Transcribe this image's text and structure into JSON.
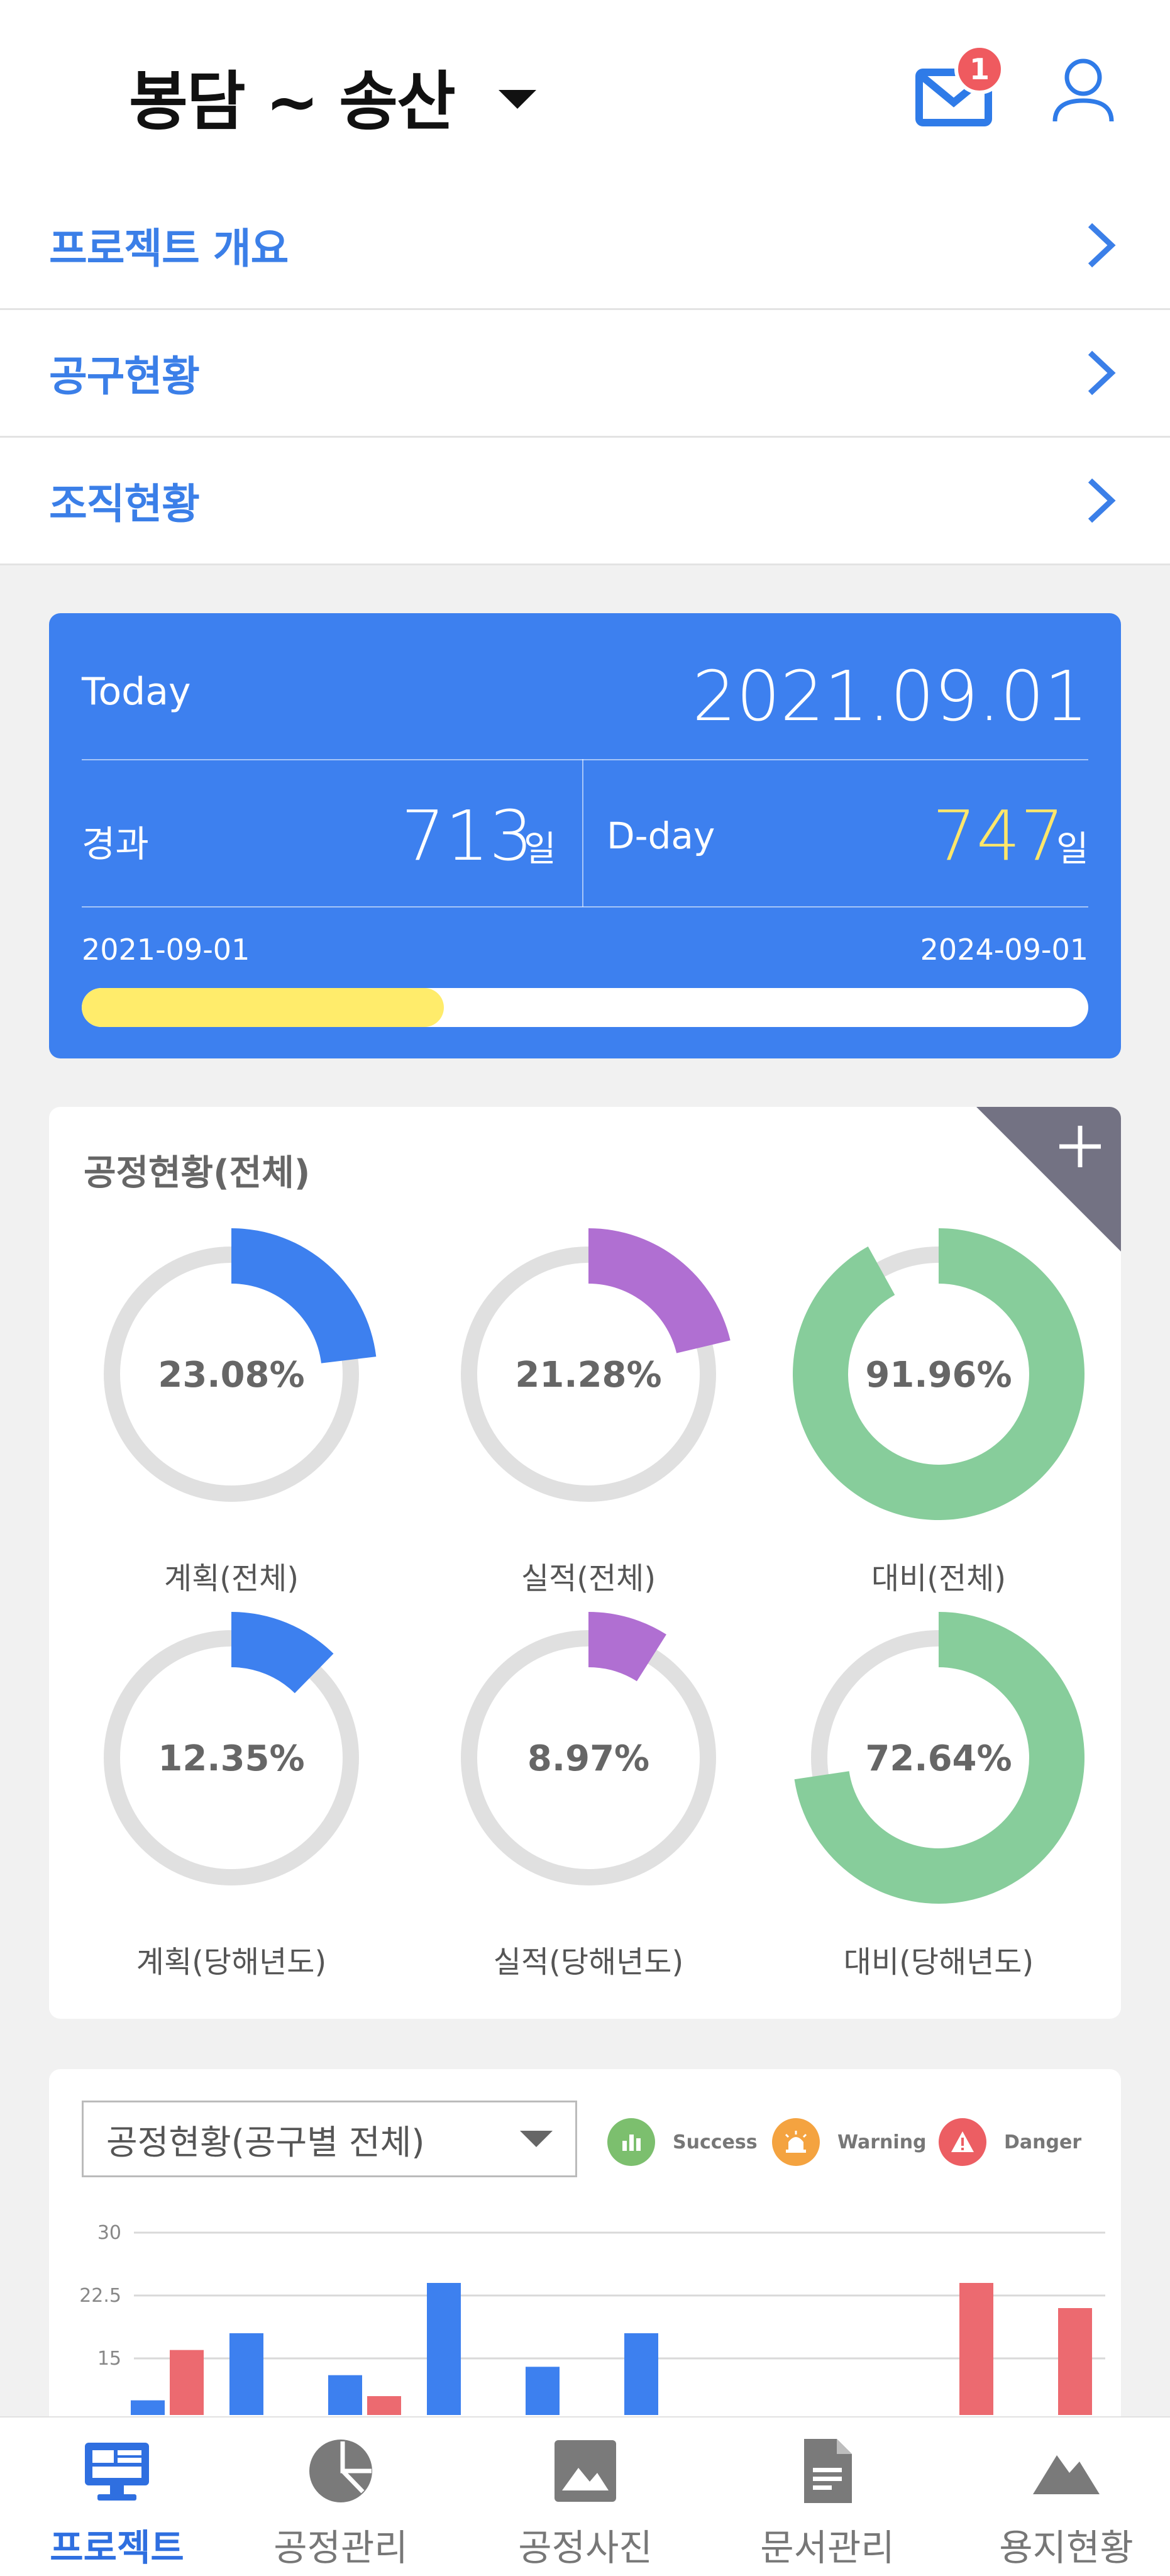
{
  "header": {
    "title": "봉담 ~ 송산",
    "mail_count": "1"
  },
  "menu": [
    {
      "label": "프로젝트 개요"
    },
    {
      "label": "공구현황"
    },
    {
      "label": "조직현황"
    }
  ],
  "today": {
    "label": "Today",
    "date": "2021.09.01",
    "elapsed_label": "경과",
    "elapsed_value": "713",
    "unit": "일",
    "dday_label": "D-day",
    "dday_value": "747",
    "start_date": "2021-09-01",
    "end_date": "2024-09-01",
    "progress": 0.36
  },
  "process": {
    "title": "공정현황(전체)",
    "donuts": [
      {
        "value": "23.08%",
        "fraction": 0.2308,
        "label": "계획(전체)",
        "color": "#3d80ef"
      },
      {
        "value": "21.28%",
        "fraction": 0.2128,
        "label": "실적(전체)",
        "color": "#b06fd2"
      },
      {
        "value": "91.96%",
        "fraction": 0.9196,
        "label": "대비(전체)",
        "color": "#87cd9b"
      },
      {
        "value": "12.35%",
        "fraction": 0.1235,
        "label": "계획(당해년도)",
        "color": "#3d80ef"
      },
      {
        "value": "8.97%",
        "fraction": 0.0897,
        "label": "실적(당해년도)",
        "color": "#b06fd2"
      },
      {
        "value": "72.64%",
        "fraction": 0.7264,
        "label": "대비(당해년도)",
        "color": "#87cd9b"
      }
    ]
  },
  "chart_section": {
    "select_value": "공정현황(공구별 전체)",
    "legend": [
      {
        "label": "Success",
        "color": "#7cbf6e",
        "icon": "bar-chart-icon"
      },
      {
        "label": "Warning",
        "color": "#f4a340",
        "icon": "alarm-icon"
      },
      {
        "label": "Danger",
        "color": "#ec5e63",
        "icon": "alert-triangle-icon"
      }
    ]
  },
  "chart_data": {
    "type": "bar",
    "ylim": [
      0,
      30
    ],
    "yticks": [
      "30",
      "22.5",
      "15"
    ],
    "series": [
      {
        "color": "#3d80ef",
        "values": [
          10,
          18,
          13,
          24,
          14,
          18,
          0,
          0,
          0,
          0
        ]
      },
      {
        "color": "#ec6a70",
        "values": [
          16,
          0,
          10.5,
          0,
          0,
          0,
          0,
          0,
          24,
          21
        ]
      }
    ]
  },
  "nav": [
    {
      "label": "프로젝트",
      "icon": "monitor-icon",
      "active": true
    },
    {
      "label": "공정관리",
      "icon": "pie-chart-icon",
      "active": false
    },
    {
      "label": "공정사진",
      "icon": "image-icon",
      "active": false
    },
    {
      "label": "문서관리",
      "icon": "document-icon",
      "active": false
    },
    {
      "label": "용지현황",
      "icon": "mountain-icon",
      "active": false
    }
  ]
}
